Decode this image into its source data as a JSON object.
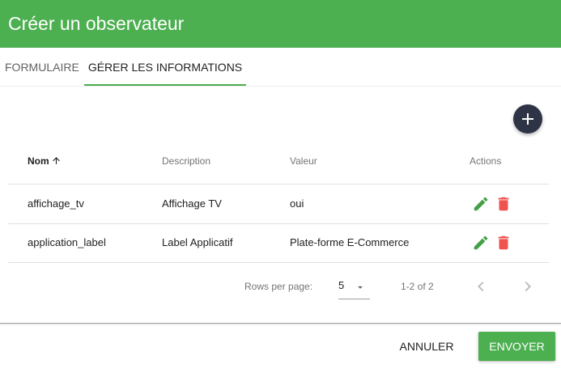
{
  "header": {
    "title": "Créer un observateur"
  },
  "tabs": [
    {
      "label": "FORMULAIRE"
    },
    {
      "label": "GÉRER LES INFORMATIONS"
    }
  ],
  "table": {
    "columns": {
      "nom": "Nom",
      "description": "Description",
      "valeur": "Valeur",
      "actions": "Actions"
    },
    "rows": [
      {
        "nom": "affichage_tv",
        "description": "Affichage TV",
        "valeur": "oui"
      },
      {
        "nom": "application_label",
        "description": "Label Applicatif",
        "valeur": "Plate-forme E-Commerce"
      }
    ]
  },
  "pagination": {
    "rows_per_page_label": "Rows per page:",
    "rows_per_page_value": "5",
    "page_info": "1-2 of 2"
  },
  "actions": {
    "cancel_label": "ANNULER",
    "submit_label": "ENVOYER"
  },
  "colors": {
    "primary": "#4caf50",
    "fab": "#2e3445",
    "edit_icon": "#43a047",
    "delete_icon": "#ef5350"
  },
  "icons": {
    "fab": "add-icon",
    "sort": "arrow-up-icon",
    "edit": "pencil-icon",
    "delete": "trash-icon",
    "select": "caret-down-icon",
    "prev": "chevron-left-icon",
    "next": "chevron-right-icon"
  }
}
